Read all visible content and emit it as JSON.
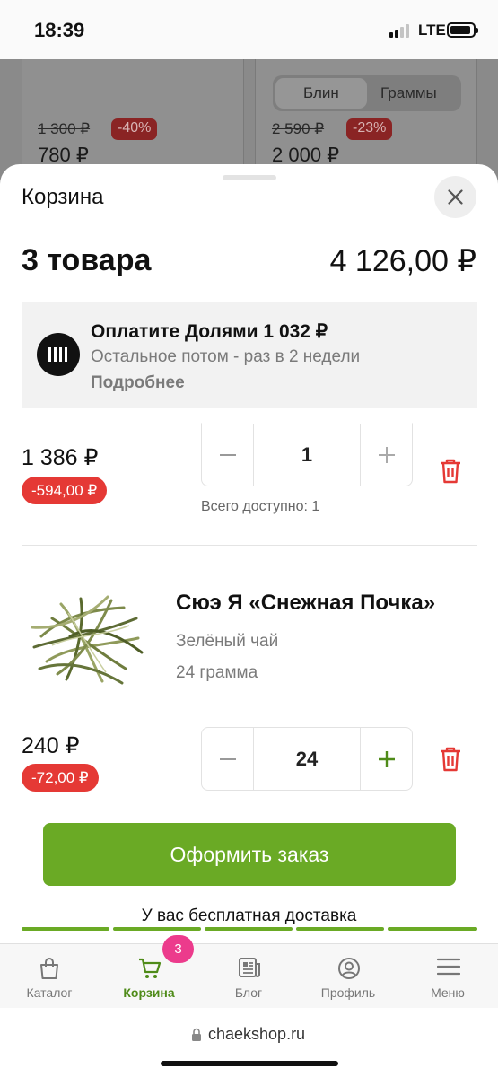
{
  "status_bar": {
    "time": "18:39",
    "network": "LTE"
  },
  "background": {
    "left_card": {
      "old_price": "1 300 ₽",
      "discount": "-40%",
      "price": "780 ₽"
    },
    "right_card": {
      "toggle_options": [
        "Блин",
        "Граммы"
      ],
      "old_price": "2 590 ₽",
      "discount": "-23%",
      "price": "2 000 ₽"
    }
  },
  "cart": {
    "title": "Корзина",
    "items_count": "3 товара",
    "total": "4 126,00 ₽",
    "dolyami": {
      "title": "Оплатите Долями 1 032 ₽",
      "subtitle": "Остальное потом - раз в 2 недели",
      "link": "Подробнее"
    },
    "items": [
      {
        "price": "1 386 ₽",
        "discount": "-594,00 ₽",
        "quantity": "1",
        "availability": "Всего доступно: 1"
      },
      {
        "name": "Сюэ Я «Снежная Почка»",
        "type": "Зелёный чай",
        "weight": "24 грамма",
        "price": "240 ₽",
        "discount": "-72,00 ₽",
        "quantity": "24"
      }
    ],
    "order_button": "Оформить заказ",
    "free_delivery": "У вас бесплатная доставка"
  },
  "nav": {
    "items": [
      {
        "label": "Каталог",
        "icon": "bag-icon"
      },
      {
        "label": "Корзина",
        "icon": "cart-icon",
        "active": true
      },
      {
        "label": "Блог",
        "icon": "newspaper-icon"
      },
      {
        "label": "Профиль",
        "icon": "user-icon"
      },
      {
        "label": "Меню",
        "icon": "menu-icon"
      }
    ],
    "cart_badge": "3"
  },
  "browser": {
    "url": "chaekshop.ru"
  },
  "colors": {
    "accent": "#6aaa25",
    "discount": "#e53935",
    "badge": "#ec3b8c",
    "trash": "#e53935"
  }
}
